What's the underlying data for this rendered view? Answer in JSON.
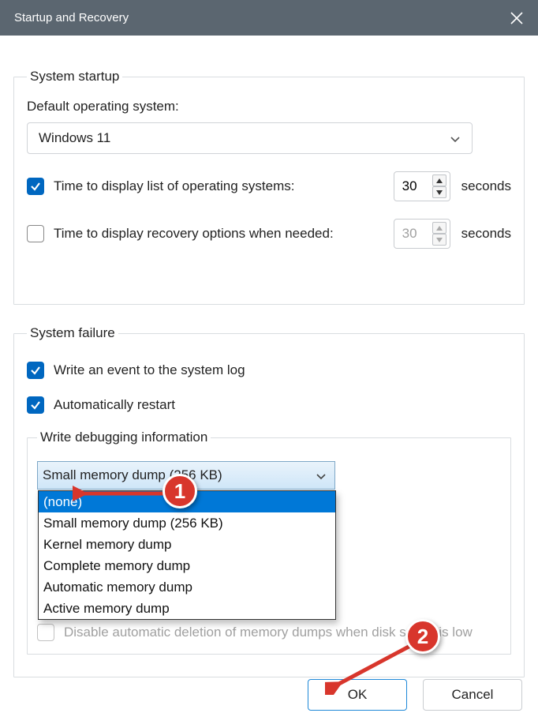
{
  "window": {
    "title": "Startup and Recovery"
  },
  "system_startup": {
    "legend": "System startup",
    "default_os_label": "Default operating system:",
    "default_os_value": "Windows 11",
    "display_list": {
      "checked": true,
      "label": "Time to display list of operating systems:",
      "value": "30",
      "unit": "seconds"
    },
    "display_recovery": {
      "checked": false,
      "label": "Time to display recovery options when needed:",
      "value": "30",
      "unit": "seconds"
    }
  },
  "system_failure": {
    "legend": "System failure",
    "write_event": {
      "checked": true,
      "label": "Write an event to the system log"
    },
    "auto_restart": {
      "checked": true,
      "label": "Automatically restart"
    },
    "debug_legend": "Write debugging information",
    "dump_select_value": "Small memory dump (256 KB)",
    "dump_options": [
      "(none)",
      "Small memory dump (256 KB)",
      "Kernel memory dump",
      "Complete memory dump",
      "Automatic memory dump",
      "Active memory dump"
    ],
    "disable_row": {
      "checked": false,
      "label": "Disable automatic deletion of memory dumps when disk space is low"
    }
  },
  "buttons": {
    "ok": "OK",
    "cancel": "Cancel"
  },
  "markers": {
    "m1": "1",
    "m2": "2"
  }
}
